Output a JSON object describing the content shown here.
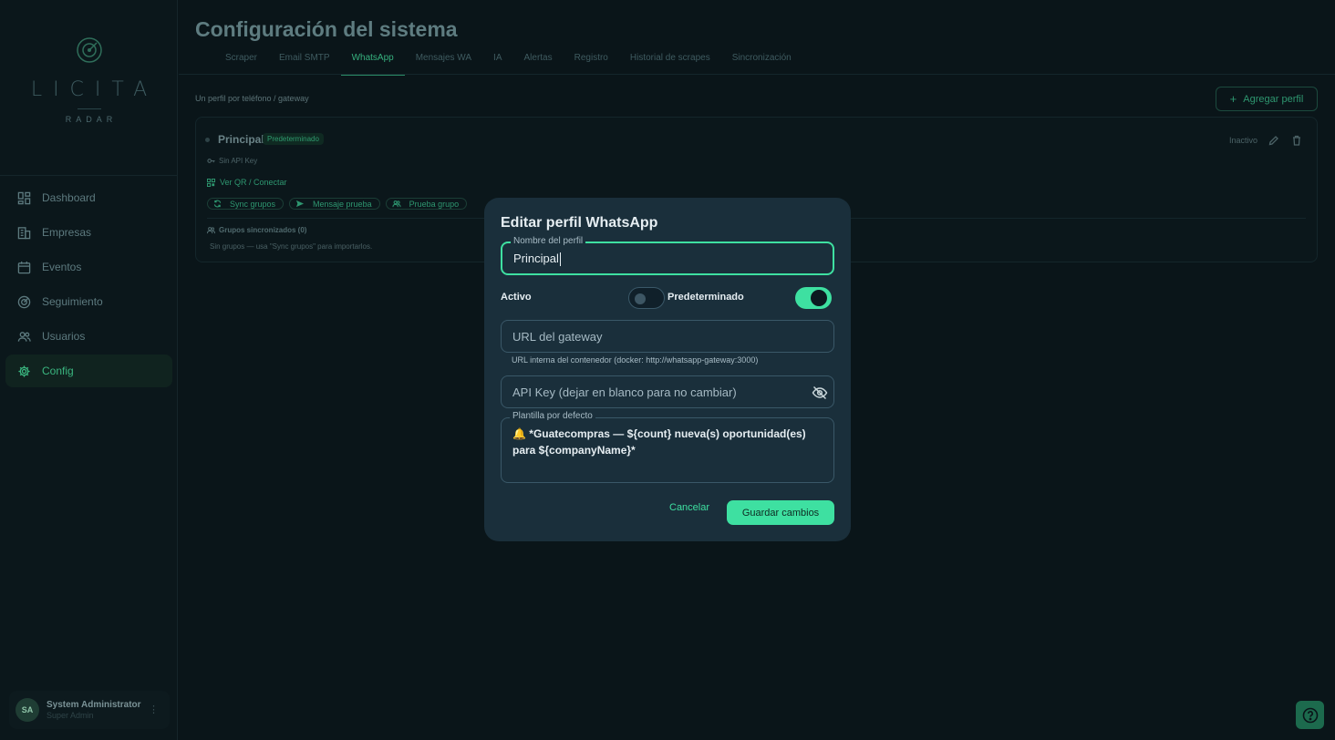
{
  "brand": {
    "name": "LICITA",
    "sub": "RADAR"
  },
  "sidebar": {
    "items": [
      {
        "label": "Dashboard",
        "icon": "dashboard-icon"
      },
      {
        "label": "Empresas",
        "icon": "building-icon"
      },
      {
        "label": "Eventos",
        "icon": "calendar-icon"
      },
      {
        "label": "Seguimiento",
        "icon": "radar-icon"
      },
      {
        "label": "Usuarios",
        "icon": "users-icon"
      },
      {
        "label": "Config",
        "icon": "gear-icon",
        "active": true
      }
    ]
  },
  "user": {
    "initials": "SA",
    "name": "System Administrator",
    "role": "Super Admin"
  },
  "page": {
    "title": "Configuración del sistema",
    "tabs": [
      "Scraper",
      "Email SMTP",
      "WhatsApp",
      "Mensajes WA",
      "IA",
      "Alertas",
      "Registro",
      "Historial de scrapes",
      "Sincronización"
    ],
    "active_tab": "WhatsApp",
    "subtitle": "Un perfil por teléfono / gateway",
    "add_button": "Agregar perfil"
  },
  "profile_card": {
    "name": "Principal",
    "badge": "Predeterminado",
    "status": "Inactivo",
    "api_key": "Sin API Key",
    "qr_link": "Ver QR / Conectar",
    "actions": [
      "Sync grupos",
      "Mensaje prueba",
      "Prueba grupo"
    ],
    "groups_title": "Grupos sincronizados (0)",
    "groups_empty": "Sin grupos — usa \"Sync grupos\" para importarlos."
  },
  "modal": {
    "title": "Editar perfil WhatsApp",
    "name_label": "Nombre del perfil",
    "name_value": "Principal",
    "active_label": "Activo",
    "active_on": false,
    "default_label": "Predeterminado",
    "default_on": true,
    "gateway_placeholder": "URL del gateway",
    "gateway_helper": "URL interna del contenedor (docker: http://whatsapp-gateway:3000)",
    "apikey_placeholder": "API Key (dejar en blanco para no cambiar)",
    "template_label": "Plantilla por defecto",
    "template_value": "🔔 *Guatecompras — ${count} nueva(s) oportunidad(es) para ${companyName}*",
    "cancel": "Cancelar",
    "save": "Guardar cambios"
  },
  "colors": {
    "accent": "#3ee0a1",
    "modal_bg": "#1a2f3b",
    "page_bg": "#0a1519"
  }
}
